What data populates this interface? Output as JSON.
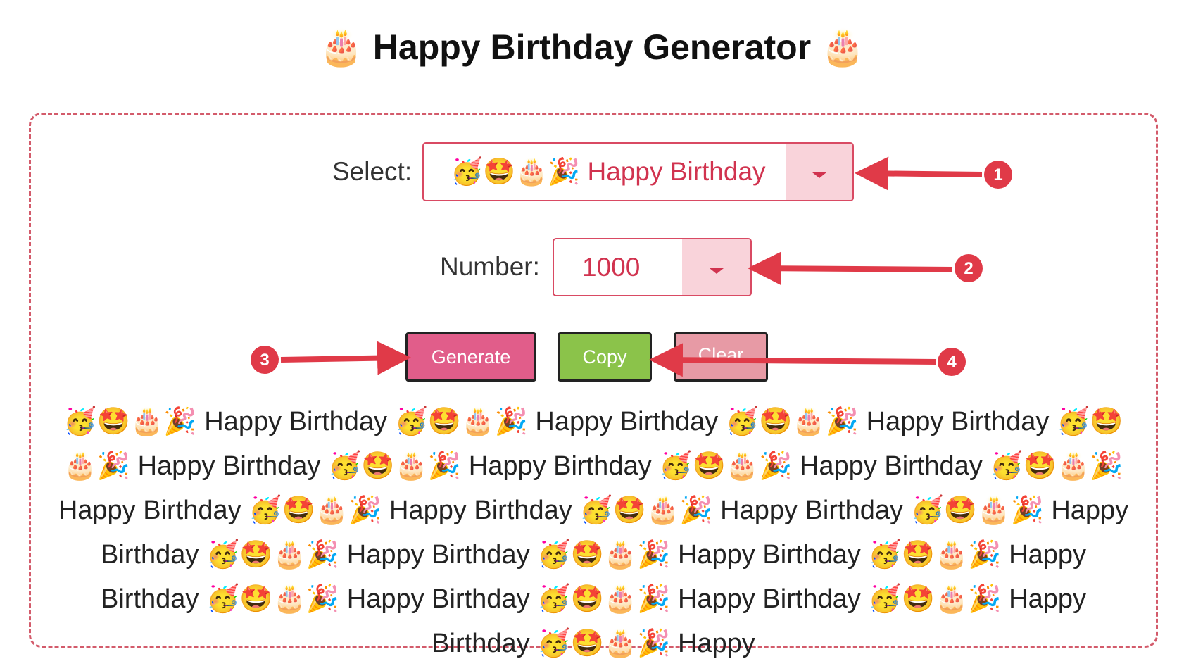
{
  "page": {
    "title": "🎂 Happy Birthday Generator 🎂"
  },
  "form": {
    "select_label": "Select:",
    "select_value": "🥳🤩🎂🎉 Happy Birthday",
    "number_label": "Number:",
    "number_value": "1000"
  },
  "buttons": {
    "generate": "Generate",
    "copy": "Copy",
    "clear": "Clear"
  },
  "annotations": [
    "1",
    "2",
    "3",
    "4"
  ],
  "output": {
    "text": "🥳🤩🎂🎉 Happy Birthday 🥳🤩🎂🎉 Happy Birthday 🥳🤩🎂🎉 Happy Birthday 🥳🤩🎂🎉 Happy Birthday 🥳🤩🎂🎉 Happy Birthday 🥳🤩🎂🎉 Happy Birthday 🥳🤩🎂🎉 Happy Birthday 🥳🤩🎂🎉 Happy Birthday 🥳🤩🎂🎉 Happy Birthday 🥳🤩🎂🎉 Happy Birthday 🥳🤩🎂🎉 Happy Birthday 🥳🤩🎂🎉 Happy Birthday 🥳🤩🎂🎉 Happy Birthday 🥳🤩🎂🎉 Happy Birthday 🥳🤩🎂🎉 Happy Birthday 🥳🤩🎂🎉 Happy Birthday 🥳🤩🎂🎉 Happy"
  },
  "colors": {
    "accent": "#d1334f",
    "border_dashed": "#d35b6b",
    "generate_button": "#e15d8a",
    "copy_button": "#8bc34a",
    "clear_button": "#e79aa5",
    "annotation_red": "#e03a48"
  }
}
